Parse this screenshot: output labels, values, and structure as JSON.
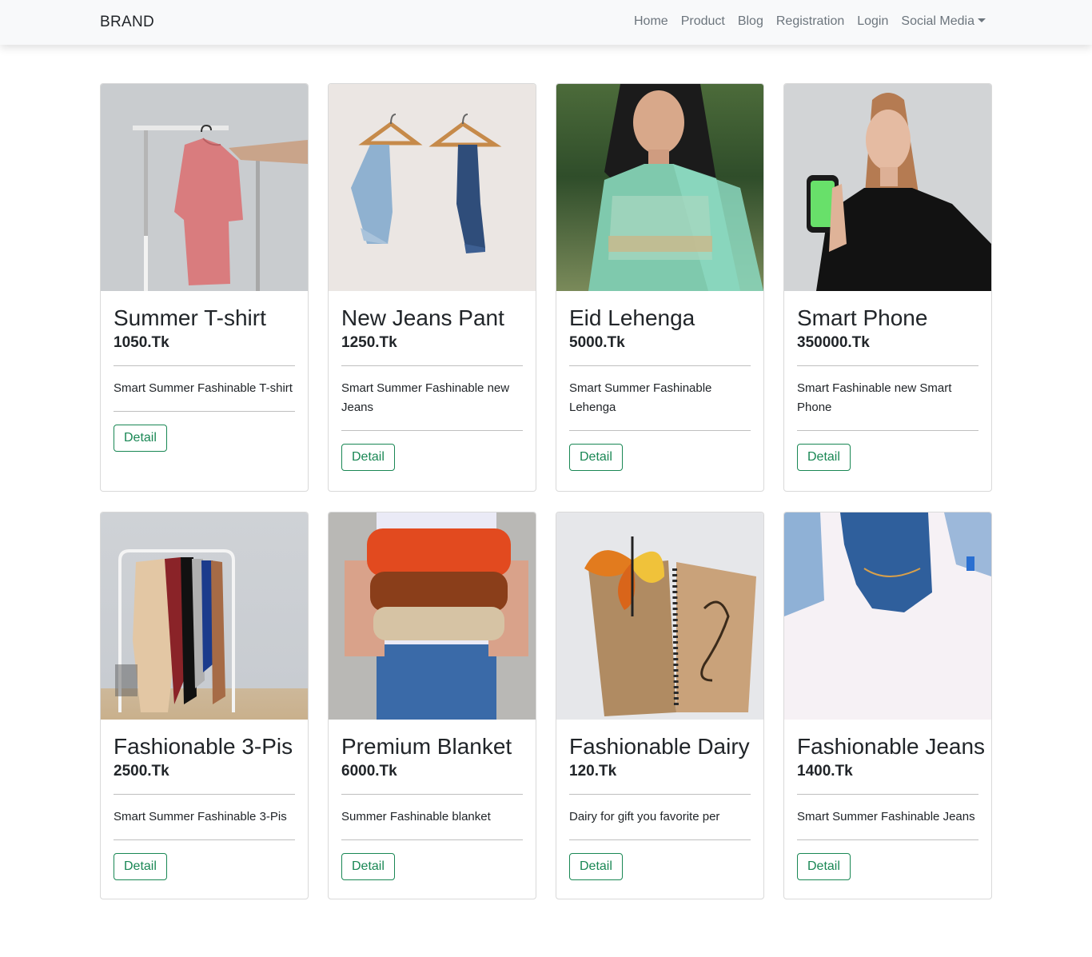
{
  "navbar": {
    "brand": "BRAND",
    "links": [
      "Home",
      "Product",
      "Blog",
      "Registration",
      "Login",
      "Social Media"
    ]
  },
  "products": [
    {
      "title": "Summer T-shirt",
      "price": "1050.Tk",
      "desc": "Smart Summer Fashinable T-shirt",
      "button": "Detail"
    },
    {
      "title": "New Jeans Pant",
      "price": "1250.Tk",
      "desc": "Smart Summer Fashinable new Jeans",
      "button": "Detail"
    },
    {
      "title": "Eid Lehenga",
      "price": "5000.Tk",
      "desc": "Smart Summer Fashinable Lehenga",
      "button": "Detail"
    },
    {
      "title": "Smart Phone",
      "price": "350000.Tk",
      "desc": "Smart Fashinable new Smart Phone",
      "button": "Detail"
    },
    {
      "title": "Fashionable 3-Pis",
      "price": "2500.Tk",
      "desc": "Smart Summer Fashinable 3-Pis",
      "button": "Detail"
    },
    {
      "title": "Premium Blanket",
      "price": "6000.Tk",
      "desc": "Summer Fashinable blanket",
      "button": "Detail"
    },
    {
      "title": "Fashionable Dairy",
      "price": "120.Tk",
      "desc": "Dairy for gift you favorite per",
      "button": "Detail"
    },
    {
      "title": "Fashionable Jeans",
      "price": "1400.Tk",
      "desc": "Smart Summer Fashinable Jeans",
      "button": "Detail"
    }
  ],
  "colors": {
    "navbar_bg": "#f8f9fa",
    "nav_link": "#6c757d",
    "button_outline": "#198754"
  }
}
